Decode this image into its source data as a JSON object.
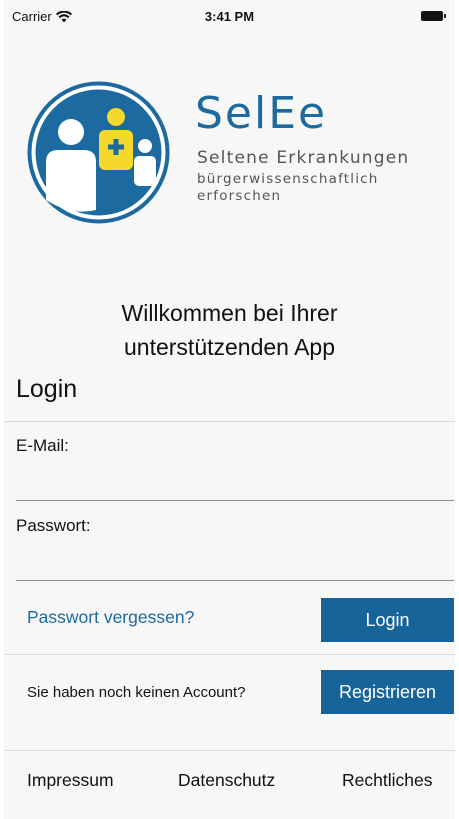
{
  "status_bar": {
    "carrier": "Carrier",
    "time": "3:41 PM",
    "wifi_icon": "wifi-icon",
    "battery_icon": "battery-icon"
  },
  "brand": {
    "logo_icon": "selee-logo",
    "name": "SelEe",
    "tagline_line1": "Seltene Erkrankungen",
    "tagline_line2": "bürgerwissenschaftlich",
    "tagline_line3": "erforschen",
    "colors": {
      "primary": "#1c6aa0",
      "accent_yellow": "#f5d92a"
    }
  },
  "welcome": {
    "line1": "Willkommen bei Ihrer",
    "line2": "unterstützenden App"
  },
  "login": {
    "title": "Login",
    "email_label": "E-Mail:",
    "email_value": "",
    "password_label": "Passwort:",
    "password_value": "",
    "forgot_password": "Passwort vergessen?",
    "login_button": "Login"
  },
  "register": {
    "prompt": "Sie haben noch keinen Account?",
    "button": "Registrieren"
  },
  "footer": {
    "impressum": "Impressum",
    "datenschutz": "Datenschutz",
    "rechtliches": "Rechtliches"
  }
}
